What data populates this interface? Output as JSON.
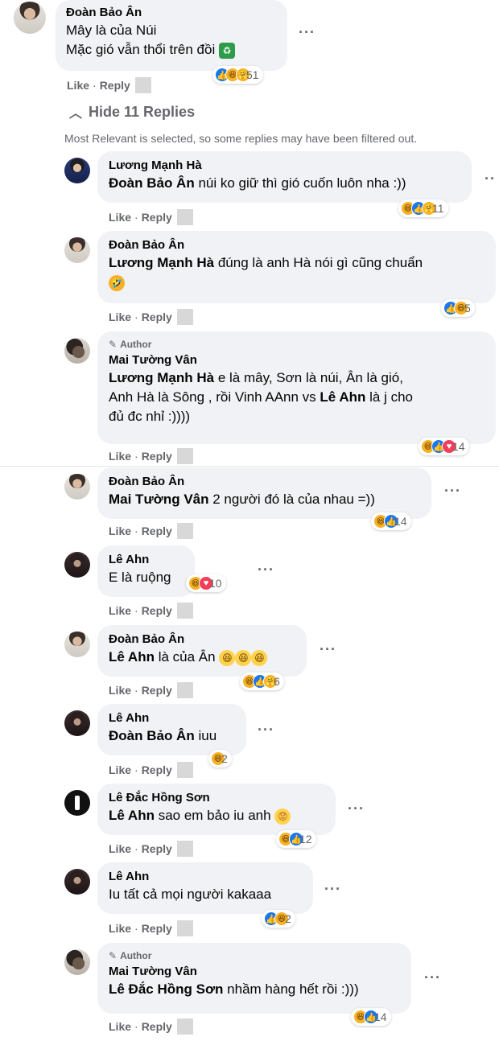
{
  "top_comment": {
    "name": "Đoàn Bảo Ân",
    "line1": "Mây là của Núi",
    "line2": "Mặc gió vẫn thổi trên đồi",
    "line2_emoji": "recycle-emoji",
    "like": "Like",
    "reply": "Reply",
    "reaction_count": "51"
  },
  "replies_toggle": {
    "label": "Hide 11 Replies",
    "note": "Most Relevant is selected, so some replies may have been filtered out."
  },
  "author_badge": "Author",
  "replies": [
    {
      "name": "Lương Mạnh Hà",
      "mention": "Đoàn Bảo Ân",
      "text": " núi ko giữ thì gió cuốn luôn nha :))",
      "count": "11"
    },
    {
      "name": "Đoàn Bảo Ân",
      "mention": "Lương Mạnh Hà",
      "text": " đúng là anh Hà nói gì cũng chuẩn",
      "count": "5"
    },
    {
      "name": "Mai Tường Vân",
      "mention": "Lương Mạnh Hà",
      "text": " e là mây, Sơn là núi, Ân là gió,",
      "line2a": "Anh Hà là Sông , rồi Vinh AAnn vs ",
      "line2_mention": "Lê Ahn",
      "line2b": " là j cho",
      "line3": "đủ đc nhỉ :))))",
      "count": "14"
    },
    {
      "name": "Đoàn Bảo Ân",
      "mention": "Mai Tường Vân",
      "text": " 2 người đó là của nhau =))",
      "count": "14"
    },
    {
      "name": "Lê Ahn",
      "text": "E là ruộng",
      "count": "10"
    },
    {
      "name": "Đoàn Bảo Ân",
      "mention": "Lê Ahn",
      "text": " là của Ân",
      "count": "6"
    },
    {
      "name": "Lê Ahn",
      "mention": "Đoàn Bảo Ân",
      "text": " iuu",
      "count": "2"
    },
    {
      "name": "Lê Đắc Hồng Sơn",
      "mention": "Lê Ahn",
      "text": " sao em bảo iu anh",
      "count": "12"
    },
    {
      "name": "Lê Ahn",
      "text": "Iu tất cả mọi người kakaaa",
      "count": "2"
    },
    {
      "name": "Mai Tường Vân",
      "mention": "Lê Đắc Hồng Sơn",
      "text": " nhầm hàng hết rồi :)))",
      "count": "14"
    }
  ],
  "actions": {
    "like": "Like",
    "reply": "Reply"
  },
  "colors": {
    "bubble": "#f0f2f5",
    "secondary_text": "#65676b",
    "like_blue": "#1877f2",
    "haha_yellow": "#f7b125",
    "love_red": "#f33e58"
  }
}
